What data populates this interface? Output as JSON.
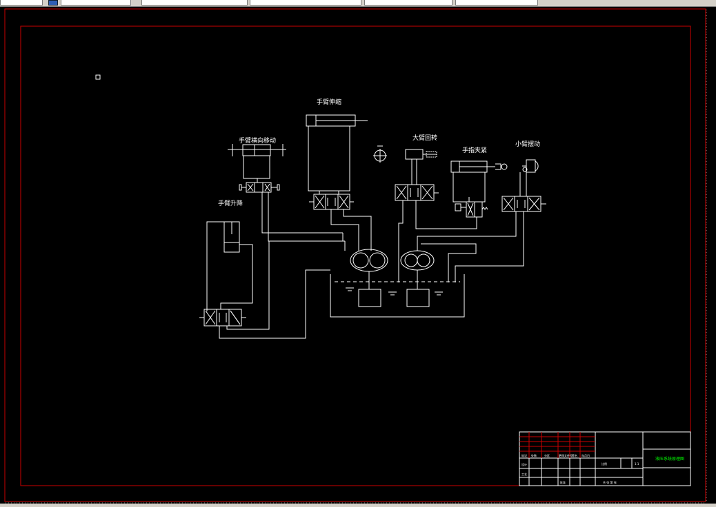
{
  "labels": {
    "arm_lateral_move": "手臂横向移动",
    "arm_extend": "手臂伸缩",
    "arm_lift": "手臂升降",
    "big_arm_rotate": "大臂回转",
    "finger_clamp": "手指夹紧",
    "small_arm_swing": "小臂摆动"
  },
  "title_block": {
    "drawing_title": "液压系统原理图",
    "scale_label": "比例",
    "ratio": "1:1",
    "sheet_info": "共 张 第 张",
    "revision_row": [
      "标记",
      "处数",
      "分区",
      "更改文件号",
      "签名",
      "年月日"
    ],
    "design_label": "设计",
    "craft_label": "工艺",
    "approve_label": "批准"
  },
  "colors": {
    "background": "#000000",
    "lines": "#ffffff",
    "frame": "#cc0000",
    "title_text": "#00ff00"
  }
}
